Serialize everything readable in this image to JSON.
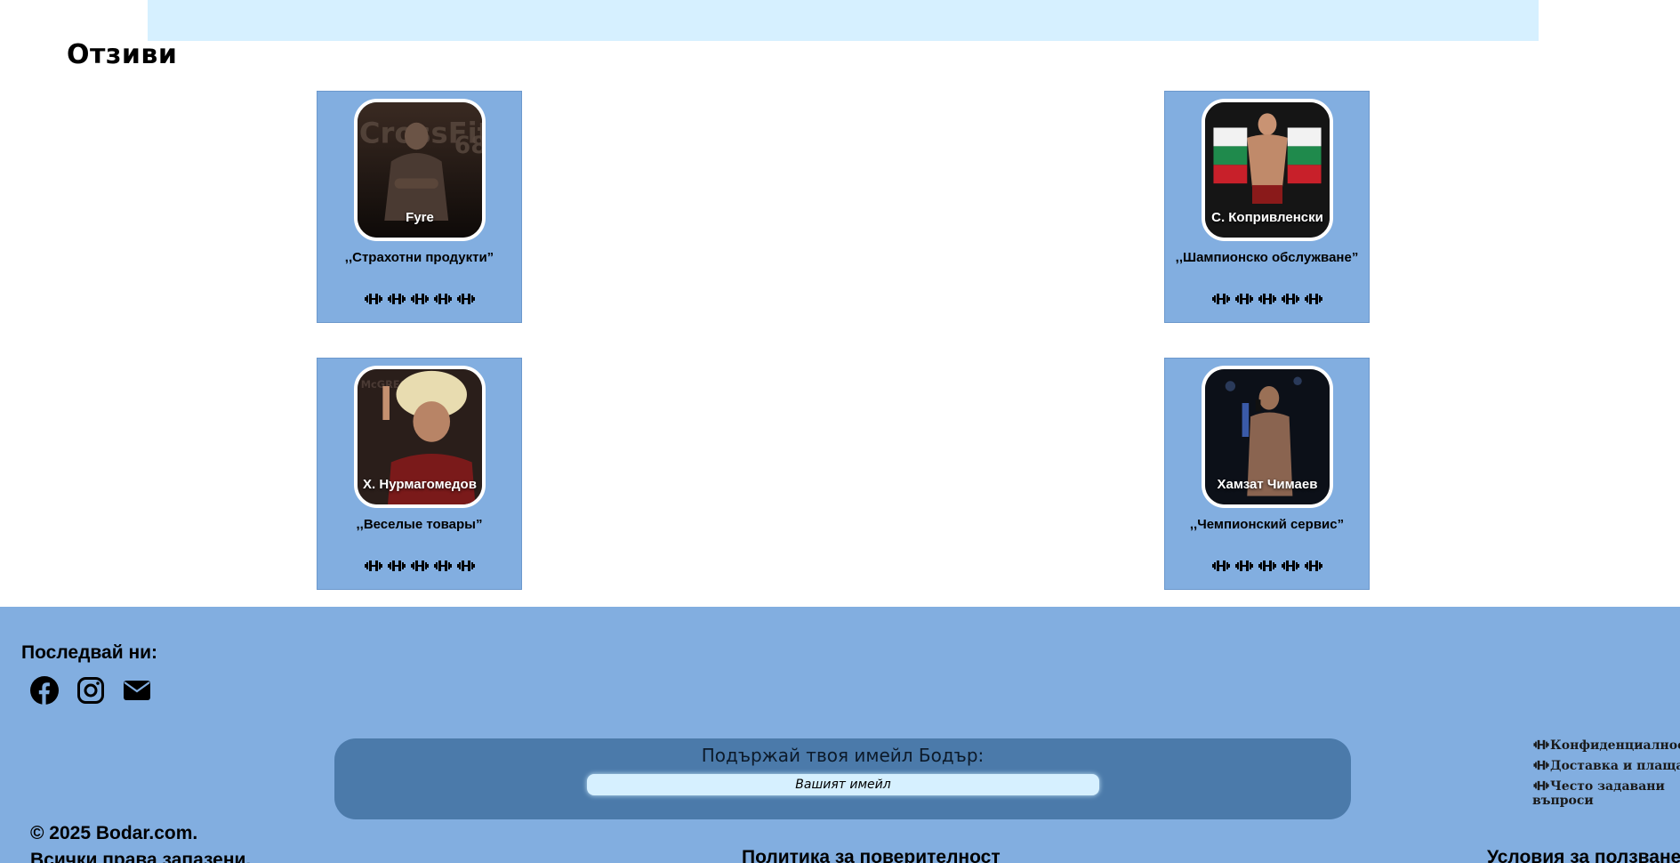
{
  "section_title": "Отзиви",
  "testimonials": [
    {
      "name": "Fyre",
      "quote": ",,Страхотни продукти”",
      "rating": 5,
      "photo_icon": "gym-portrait-photo"
    },
    {
      "name": "С. Копривленски",
      "quote": ",,Шампионско обслужване”",
      "rating": 5,
      "photo_icon": "fighter-with-flag-photo"
    },
    {
      "name": "Х. Нурмагомедов",
      "quote": ",,Веселые товары”",
      "rating": 5,
      "photo_icon": "fighter-in-papakha-photo"
    },
    {
      "name": "Хамзат Чимаев",
      "quote": ",,Чемпионский сервис”",
      "rating": 5,
      "photo_icon": "fighter-with-microphone-photo"
    }
  ],
  "footer": {
    "follow_label": "Последвай ни:",
    "social_icons": [
      "facebook-icon",
      "instagram-icon",
      "envelope-icon"
    ],
    "newsletter": {
      "label": "Подържай твоя имейл Бодър:",
      "placeholder": "Вашият имейл"
    },
    "links": [
      "Конфиденциалност",
      "Доставка и плащане",
      "Често задавани въпроси"
    ],
    "copyright_line1": "© 2025 Bodar.com.",
    "copyright_line2": "Всички права запазени.",
    "policy": "Политика за поверителност",
    "terms": "Условия за ползване"
  },
  "colors": {
    "banner": "#d6f0ff",
    "card_bg": "#82aee0",
    "footer_bg": "#82aee0",
    "newsletter_bg": "#4b7aaa",
    "input_bg": "#d6f0ff"
  }
}
